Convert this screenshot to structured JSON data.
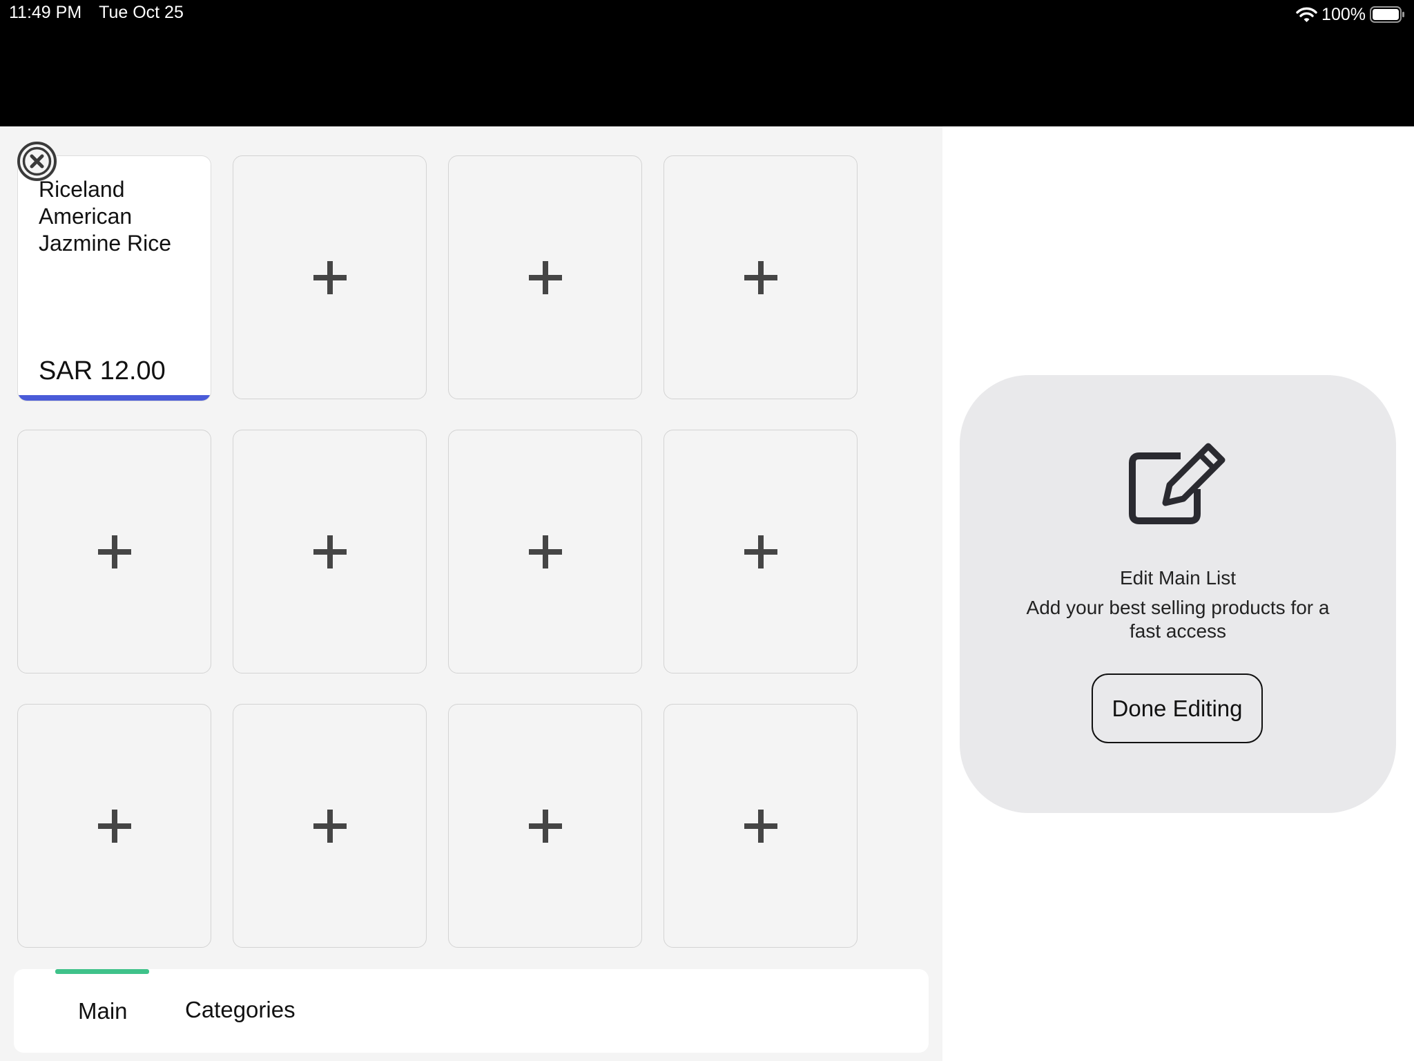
{
  "status_bar": {
    "time": "11:49 PM",
    "date": "Tue Oct 25",
    "battery": "100%",
    "wifi_icon": "wifi-icon",
    "battery_icon": "battery-full-icon"
  },
  "grid": {
    "product": {
      "name": "Riceland American Jazmine Rice",
      "price": "SAR 12.00",
      "accent_color": "#4a5bd8",
      "remove_icon": "close-circle-icon"
    },
    "empty_slot_icon": "plus-icon",
    "empty_slot_count": 11
  },
  "tabs": [
    {
      "label": "Main",
      "active": true,
      "indicator_color": "#3fc28a"
    },
    {
      "label": "Categories",
      "active": false
    }
  ],
  "edit_panel": {
    "icon": "edit-icon",
    "title": "Edit Main List",
    "description": "Add your best selling products for a fast access",
    "done_label": "Done Editing"
  }
}
